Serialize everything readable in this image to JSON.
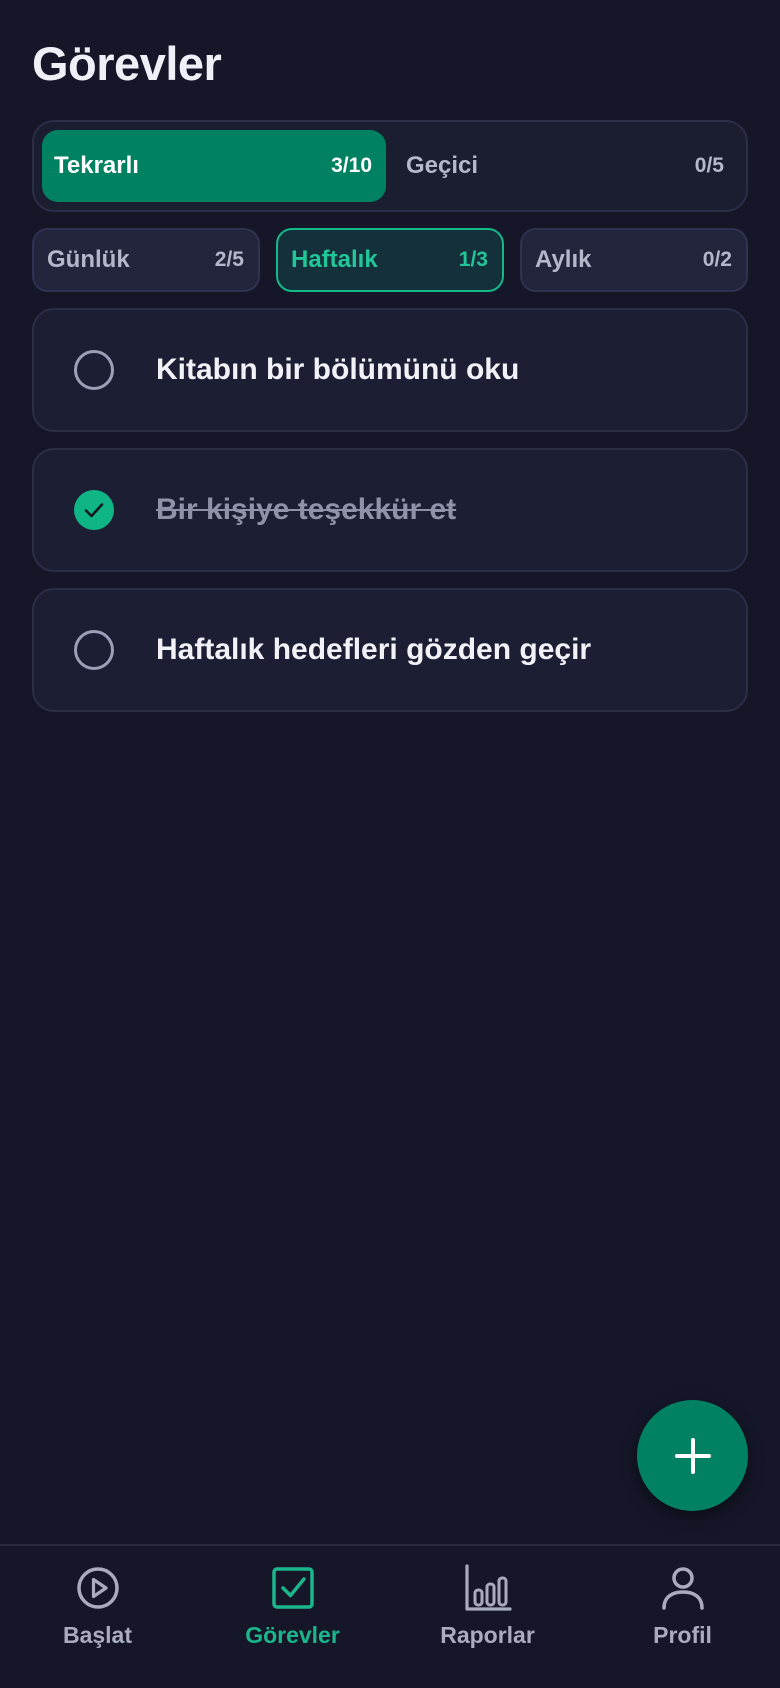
{
  "header": {
    "title": "Görevler"
  },
  "segments": [
    {
      "label": "Tekrarlı",
      "count": "3/10"
    },
    {
      "label": "Geçici",
      "count": "0/5"
    }
  ],
  "periods": [
    {
      "label": "Günlük",
      "count": "2/5"
    },
    {
      "label": "Haftalık",
      "count": "1/3"
    },
    {
      "label": "Aylık",
      "count": "0/2"
    }
  ],
  "tasks": [
    {
      "text": "Kitabın bir bölümünü oku",
      "done": false
    },
    {
      "text": "Bir kişiye teşekkür et",
      "done": true
    },
    {
      "text": "Haftalık hedefleri gözden geçir",
      "done": false
    }
  ],
  "fab": {
    "icon": "plus-icon"
  },
  "nav": [
    {
      "label": "Başlat",
      "icon": "play-circle-icon"
    },
    {
      "label": "Görevler",
      "icon": "checkbox-icon"
    },
    {
      "label": "Raporlar",
      "icon": "bar-chart-icon"
    },
    {
      "label": "Profil",
      "icon": "person-icon"
    }
  ],
  "colors": {
    "background": "#151729",
    "accent": "#008262",
    "accent_text": "#1bb68c",
    "card": "#1c1e33"
  }
}
